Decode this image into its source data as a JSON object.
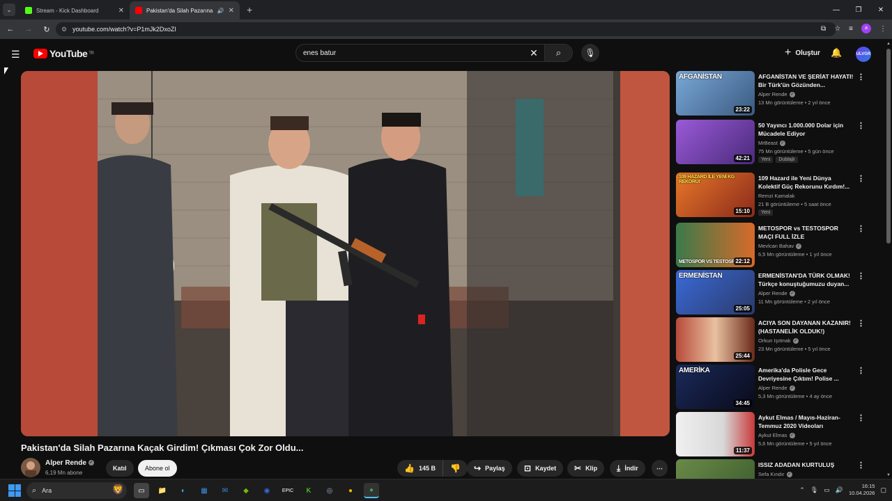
{
  "browser": {
    "tabs": [
      {
        "title": "Stream - Kick Dashboard",
        "favicon_color": "#53fc18",
        "active": false
      },
      {
        "title": "Pakistan'da Silah Pazarına K",
        "favicon_color": "#ff0000",
        "active": true
      }
    ],
    "url": "youtube.com/watch?v=P1mJk2DxoZI",
    "window_controls": [
      "minimize-icon",
      "restore-icon",
      "close-icon"
    ]
  },
  "youtube": {
    "logo_text": "YouTube",
    "region": "TR",
    "search_query": "enes batur",
    "create_label": "Oluştur",
    "avatar_text": "ULVGR"
  },
  "video": {
    "title": "Pakistan'da Silah Pazarına Kaçak Girdim! Çıkması Çok Zor Oldu...",
    "channel": "Alper Rende",
    "subscribers": "6,19 Mn abone",
    "join_label": "Katıl",
    "subscribe_label": "Abone ol",
    "likes": "145 B",
    "share_label": "Paylaş",
    "save_label": "Kaydet",
    "clip_label": "Klip",
    "download_label": "İndir"
  },
  "recommendations": [
    {
      "thumb_caption": "AFGANİSTAN",
      "thumb_color": "#4a7aa8",
      "title": "AFGANİSTAN VE ŞERİAT HAYATI! Bir Türk'ün Gözünden...",
      "channel": "Alper Rende",
      "verified": true,
      "meta": "13 Mn görüntüleme • 2 yıl önce",
      "duration": "23:22",
      "badges": []
    },
    {
      "thumb_caption": "",
      "thumb_color": "#7a3ea8",
      "title": "50 Yayıncı 1.000.000 Dolar için Mücadele Ediyor",
      "channel": "MrBeast",
      "verified": true,
      "meta": "75 Mn görüntüleme • 5 gün önce",
      "duration": "42:21",
      "badges": [
        "Yeni",
        "Dublajlı"
      ]
    },
    {
      "thumb_caption": "109 HAZARD İLE YENİ KG REKORU!",
      "thumb_color": "#c2461d",
      "title": "109 Hazard ile Yeni Dünya Kolektif Güç Rekorunu Kırdım!...",
      "channel": "Remzi Kamalak",
      "verified": false,
      "meta": "21 B görüntüleme • 5 saat önce",
      "duration": "15:10",
      "badges": [
        "Yeni"
      ]
    },
    {
      "thumb_caption": "METOSPOR VS TESTOSPOR",
      "thumb_color": "#2f6a3a",
      "title": "METOSPOR vs TESTOSPOR MAÇI FULL İZLE",
      "channel": "Mevlcan Bahav",
      "verified": true,
      "meta": "6,5 Mn görüntüleme • 1 yıl önce",
      "duration": "22:12",
      "badges": []
    },
    {
      "thumb_caption": "ERMENİSTAN",
      "thumb_color": "#2b5aa8",
      "title": "ERMENİSTAN'DA TÜRK OLMAK! Türkçe konuştuğumuzu duyan...",
      "channel": "Alper Rende",
      "verified": true,
      "meta": "11 Mn görüntüleme • 2 yıl önce",
      "duration": "25:05",
      "badges": []
    },
    {
      "thumb_caption": "",
      "thumb_color": "#8a3a2a",
      "title": "ACIYA SON DAYANAN KAZANIR! (HASTANELİK OLDUK!)",
      "channel": "Orkun Işıtmak",
      "verified": true,
      "meta": "23 Mn görüntüleme • 5 yıl önce",
      "duration": "25:44",
      "badges": []
    },
    {
      "thumb_caption": "AMERİKA",
      "thumb_color": "#1e2a4a",
      "title": "Amerika'da Polisle Gece Devriyesine Çıktım! Polise ...",
      "channel": "Alper Rende",
      "verified": true,
      "meta": "5,3 Mn görüntüleme • 4 ay önce",
      "duration": "34:45",
      "badges": []
    },
    {
      "thumb_caption": "",
      "thumb_color": "#d8d8d8",
      "title": "Aykut Elmas / Mayıs-Haziran-Temmuz 2020 Videoları",
      "channel": "Aykut Elmas",
      "verified": true,
      "meta": "5,6 Mn görüntüleme • 5 yıl önce",
      "duration": "11:37",
      "badges": []
    },
    {
      "thumb_caption": "",
      "thumb_color": "#4a6a3a",
      "title": "ISSIZ ADADAN KURTULUŞ",
      "channel": "Sefa Kındır",
      "verified": true,
      "meta": "",
      "duration": "",
      "badges": []
    }
  ],
  "taskbar": {
    "search_placeholder": "Ara",
    "time": "16:15",
    "date": "10.04.2026"
  }
}
